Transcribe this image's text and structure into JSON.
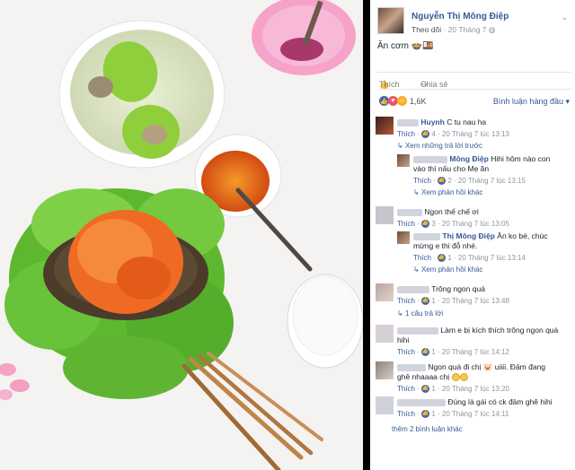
{
  "post": {
    "author_name": "Nguyễn Thị Mông Điệp",
    "follow_label": "Theo dõi",
    "date": "20 Tháng 7",
    "chevron": "⌄",
    "status_text": "Ăn cơm 🍲🍱"
  },
  "actions": {
    "like_label": "Thích",
    "share_label": "Chia sẻ"
  },
  "reactions": {
    "count": "1,6K",
    "sort_label": "Bình luận hàng đầu ▾",
    "colors": {
      "like": "#4267b2",
      "love": "#f25268",
      "haha": "#f7b125"
    }
  },
  "comments": [
    {
      "name": "Huynh",
      "text": "C tu nau ha",
      "like": "Thích",
      "count": "4",
      "time": "20 Tháng 7 lúc 13:13",
      "reply_link": "Xem những trả lời trước"
    },
    {
      "name": "Mông Điệp",
      "text1": "Hihi hôm nào con",
      "text2": "vào thì nấu cho Mẹ ăn",
      "like": "Thích",
      "count": "2",
      "time": "20 Tháng 7 lúc 13:15",
      "reply_link": "Xem phản hồi khác"
    },
    {
      "text": "Ngon thế chế ơi",
      "like": "Thích",
      "count": "3",
      "time": "20 Tháng 7 lúc 13:05"
    },
    {
      "name": "Thị Mông Điệp",
      "text1": "Ăn ko bé, chúc",
      "text2": "mừng e thi đỗ nhé.",
      "like": "Thích",
      "count": "1",
      "time": "20 Tháng 7 lúc 13:14",
      "reply_link": "Xem phản hồi khác"
    },
    {
      "text": "Trông ngon quá",
      "like": "Thích",
      "count": "1",
      "time": "20 Tháng 7 lúc 13:48",
      "reply_link": "1 câu trả lời"
    },
    {
      "text1": "Làm e bị kích thích trông ngon quá",
      "text2": "hihi",
      "like": "Thích",
      "count": "1",
      "time": "20 Tháng 7 lúc 14:12"
    },
    {
      "text1": "Ngon quá đi chị",
      "text1b": "uiiii. Đảm đang",
      "text2": "ghê nhaaaa chị",
      "like": "Thích",
      "count": "1",
      "time": "20 Tháng 7 lúc 13:20"
    },
    {
      "text": "Đúng là gái có ck đảm ghê hihi",
      "like": "Thích",
      "count": "1",
      "time": "20 Tháng 7 lúc 14:11"
    }
  ],
  "more_comments": "thêm 2 bình luận khác"
}
